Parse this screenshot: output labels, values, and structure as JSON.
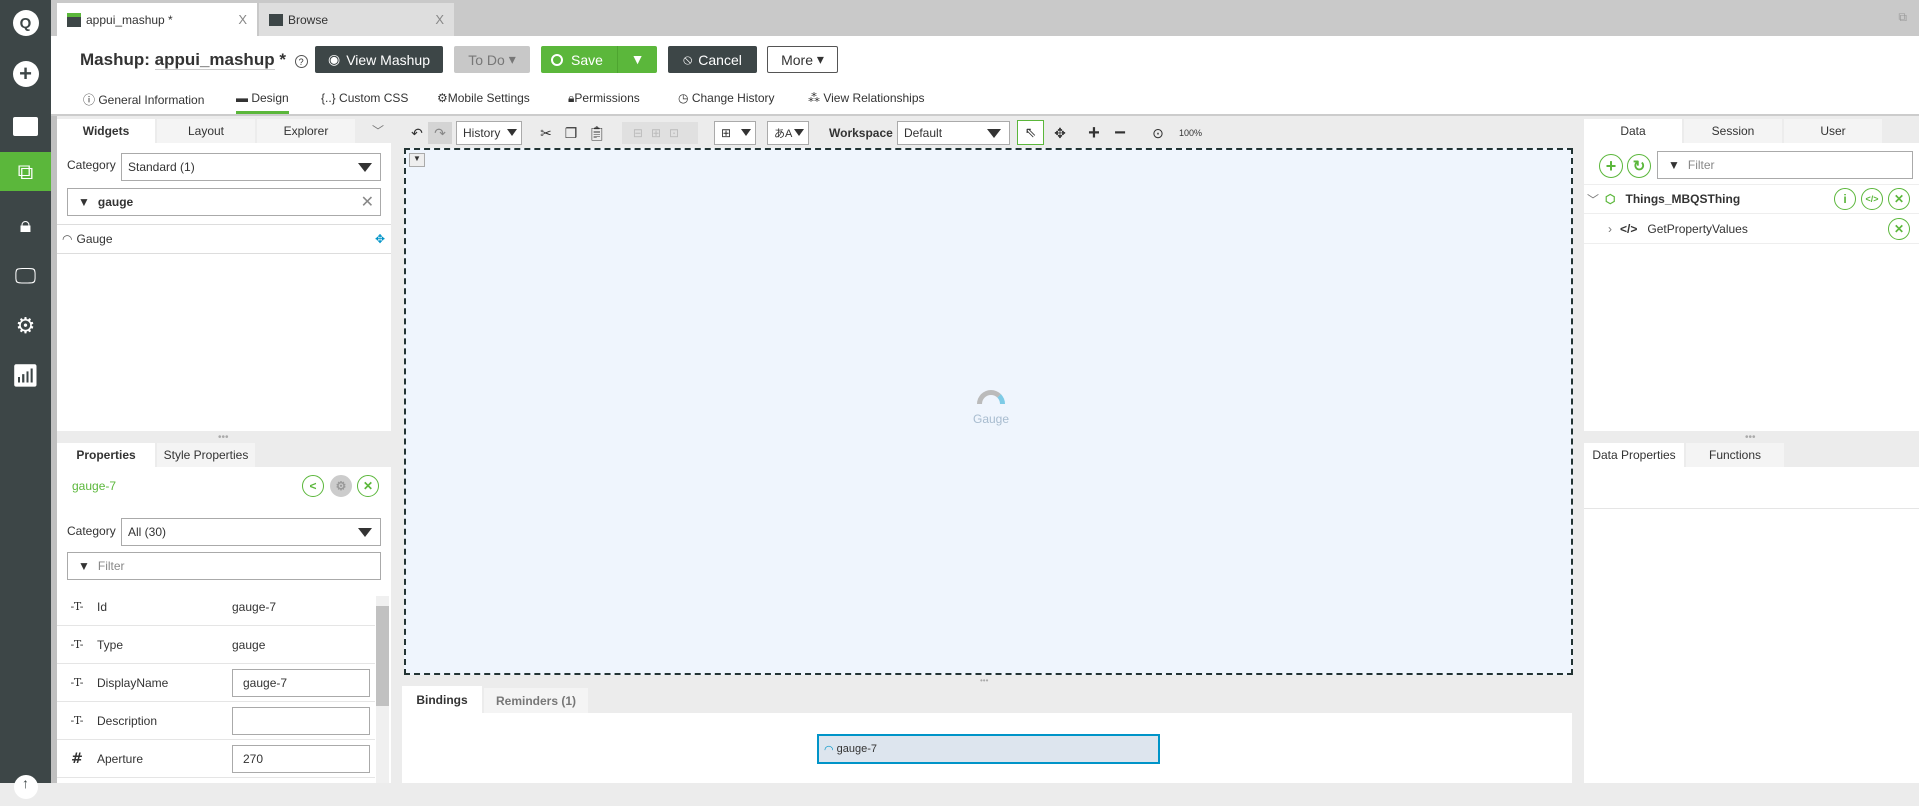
{
  "nav": {
    "items": [
      "search-icon",
      "add-icon",
      "folder-icon",
      "mashup-icon",
      "lock-icon",
      "monitor-icon",
      "gear-icon",
      "analytics-icon"
    ]
  },
  "tabs": [
    {
      "label": "appui_mashup *",
      "close": "X"
    },
    {
      "label": "Browse",
      "close": "X"
    }
  ],
  "header": {
    "title": "Mashup:",
    "name": "appui_mashup",
    "modified": "*",
    "help": "?",
    "view_mashup": "View Mashup",
    "todo": "To Do",
    "save": "Save",
    "cancel": "Cancel",
    "more": "More"
  },
  "nav_tabs": [
    "General Information",
    "Design",
    "Custom CSS",
    "Mobile Settings",
    "Permissions",
    "Change History",
    "View Relationships"
  ],
  "left": {
    "tabs": [
      "Widgets",
      "Layout",
      "Explorer"
    ],
    "category_label": "Category",
    "category_value": "Standard (1)",
    "filter_value": "gauge",
    "widgets": [
      "Gauge"
    ]
  },
  "props": {
    "tabs": [
      "Properties",
      "Style Properties"
    ],
    "widget_id": "gauge-7",
    "category_label": "Category",
    "category_value": "All (30)",
    "filter_placeholder": "Filter",
    "rows": [
      {
        "icon": "-T-",
        "name": "Id",
        "value": "gauge-7",
        "editable": false
      },
      {
        "icon": "-T-",
        "name": "Type",
        "value": "gauge",
        "editable": false
      },
      {
        "icon": "-T-",
        "name": "DisplayName",
        "value": "gauge-7",
        "editable": true
      },
      {
        "icon": "-T-",
        "name": "Description",
        "value": "",
        "editable": true
      },
      {
        "icon": "#",
        "name": "Aperture",
        "value": "270",
        "editable": true
      }
    ]
  },
  "toolbar": {
    "history": "History",
    "workspace_label": "Workspace",
    "workspace_value": "Default",
    "zoom": "100%"
  },
  "canvas": {
    "widget_label": "Gauge"
  },
  "bottom": {
    "tabs": [
      "Bindings",
      "Reminders (1)"
    ],
    "binding_widget": "gauge-7"
  },
  "right": {
    "tabs": [
      "Data",
      "Session",
      "User"
    ],
    "filter_placeholder": "Filter",
    "thing": "Things_MBQSThing",
    "service": "GetPropertyValues",
    "lower_tabs": [
      "Data Properties",
      "Functions"
    ]
  },
  "colors": {
    "accent": "#5bb73b",
    "dark": "#3d4647",
    "canvas": "#eff5fd",
    "binding": "#0094c8"
  }
}
